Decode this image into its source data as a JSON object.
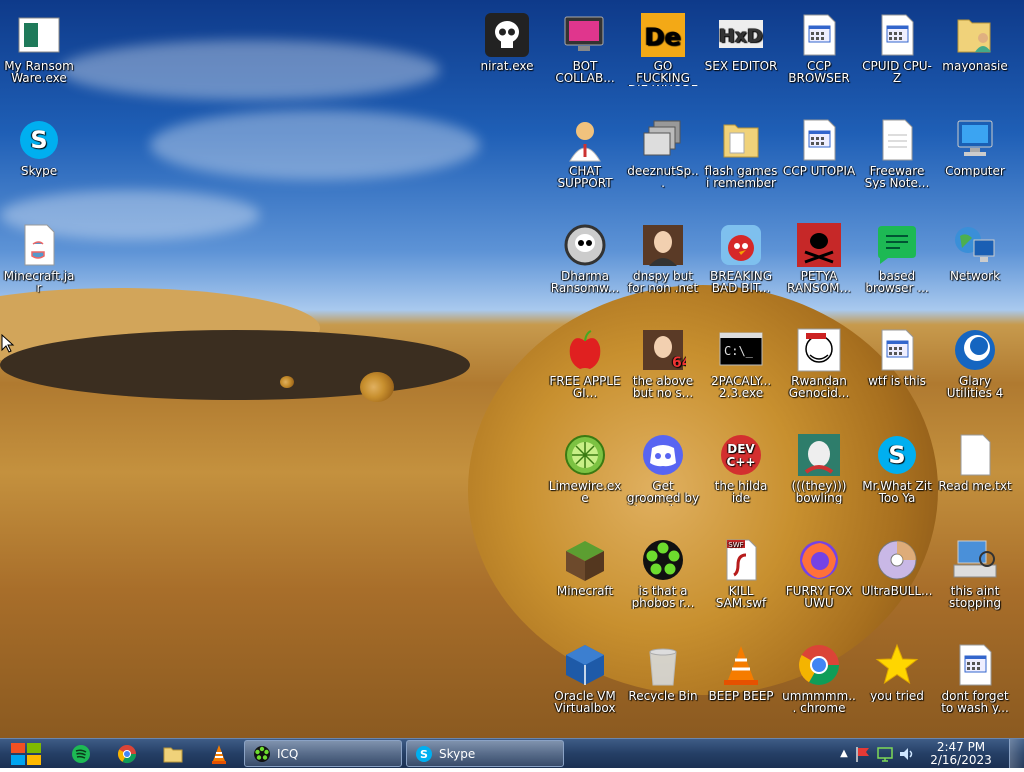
{
  "desktop": {
    "icons": [
      {
        "label": "My Ransom Ware.exe",
        "icon": "ransom-app-icon"
      },
      {
        "label": "Skype",
        "icon": "skype-icon"
      },
      {
        "label": "Minecraft.jar",
        "icon": "java-file-icon"
      },
      {
        "label": "nirat.exe",
        "icon": "skull-icon"
      },
      {
        "label": "BOT COLLAB...",
        "icon": "monitor-pink-icon"
      },
      {
        "label": "GO FUCKING DIE WHORE",
        "icon": "de-logo-icon"
      },
      {
        "label": "SEX EDITOR",
        "icon": "hxd-icon"
      },
      {
        "label": "CCP BROWSER",
        "icon": "window-file-icon"
      },
      {
        "label": "CPUID CPU-Z",
        "icon": "window-file-icon"
      },
      {
        "label": "mayonasie",
        "icon": "user-folder-icon"
      },
      {
        "label": "CHAT SUPPORT",
        "icon": "doctor-icon"
      },
      {
        "label": "deeznutSp...",
        "icon": "stacked-windows-icon"
      },
      {
        "label": "flash games i remember",
        "icon": "folder-icon"
      },
      {
        "label": "CCP UTOPIA",
        "icon": "window-file-icon"
      },
      {
        "label": "Freeware Sys Note...",
        "icon": "document-icon"
      },
      {
        "label": "Computer",
        "icon": "computer-icon"
      },
      {
        "label": "Dharma Ransomw...",
        "icon": "skull-gear-icon"
      },
      {
        "label": "dnspy but for non .net pr...",
        "icon": "portrait-icon"
      },
      {
        "label": "BREAKING BAD BIT...",
        "icon": "angry-bird-icon"
      },
      {
        "label": "PETYA RANSOM...",
        "icon": "red-skull-icon"
      },
      {
        "label": "based browser ...",
        "icon": "green-chat-icon"
      },
      {
        "label": "Network",
        "icon": "network-icon"
      },
      {
        "label": "FREE APPLE GI...",
        "icon": "apple-icon"
      },
      {
        "label": "the above but no s...",
        "icon": "portrait-64-icon"
      },
      {
        "label": "2PACALY... 2.3.exe",
        "icon": "cmd-icon"
      },
      {
        "label": "Rwandan Genocid...",
        "icon": "meme-face-icon"
      },
      {
        "label": "wtf is this",
        "icon": "window-file-icon"
      },
      {
        "label": "Glary Utilities 4",
        "icon": "glary-icon"
      },
      {
        "label": "Limewire.exe",
        "icon": "limewire-icon"
      },
      {
        "label": "Get groomed by transde...",
        "icon": "discord-icon"
      },
      {
        "label": "the hilda ide",
        "icon": "dev-cpp-icon"
      },
      {
        "label": "(((they))) bowling",
        "icon": "bowling-icon"
      },
      {
        "label": "Mr.What Zit Too Ya",
        "icon": "skype-icon"
      },
      {
        "label": "Read me.txt",
        "icon": "text-file-icon"
      },
      {
        "label": "Minecraft",
        "icon": "grass-block-icon"
      },
      {
        "label": "is that a phobos r...",
        "icon": "icq-flower-icon"
      },
      {
        "label": "KILL SAM.swf",
        "icon": "swf-icon"
      },
      {
        "label": "FURRY FOX UWU",
        "icon": "firefox-icon"
      },
      {
        "label": "UltraBULL...",
        "icon": "disc-icon"
      },
      {
        "label": "this aint stopping di...",
        "icon": "scanner-icon"
      },
      {
        "label": "Oracle VM Virtualbox",
        "icon": "virtualbox-icon"
      },
      {
        "label": "Recycle Bin",
        "icon": "recycle-bin-icon"
      },
      {
        "label": "BEEP BEEP",
        "icon": "vlc-cone-icon"
      },
      {
        "label": "ummmmm... chrome",
        "icon": "chrome-icon"
      },
      {
        "label": "you tried",
        "icon": "star-icon"
      },
      {
        "label": "dont forget to wash y...",
        "icon": "window-file-icon"
      }
    ]
  },
  "taskbar": {
    "start": {
      "icon": "windows-logo-icon"
    },
    "pinned": [
      {
        "icon": "spotify-icon"
      },
      {
        "icon": "chrome-icon"
      },
      {
        "icon": "folder-icon"
      },
      {
        "icon": "vlc-cone-icon"
      }
    ],
    "tasks": [
      {
        "label": "ICQ",
        "icon": "icq-flower-icon"
      },
      {
        "label": "Skype",
        "icon": "skype-icon"
      }
    ],
    "tray": [
      {
        "icon": "chevron-up-icon"
      },
      {
        "icon": "action-center-flag-icon"
      },
      {
        "icon": "network-tray-icon"
      },
      {
        "icon": "volume-icon"
      }
    ],
    "clock": {
      "time": "2:47 PM",
      "date": "2/16/2023"
    }
  }
}
